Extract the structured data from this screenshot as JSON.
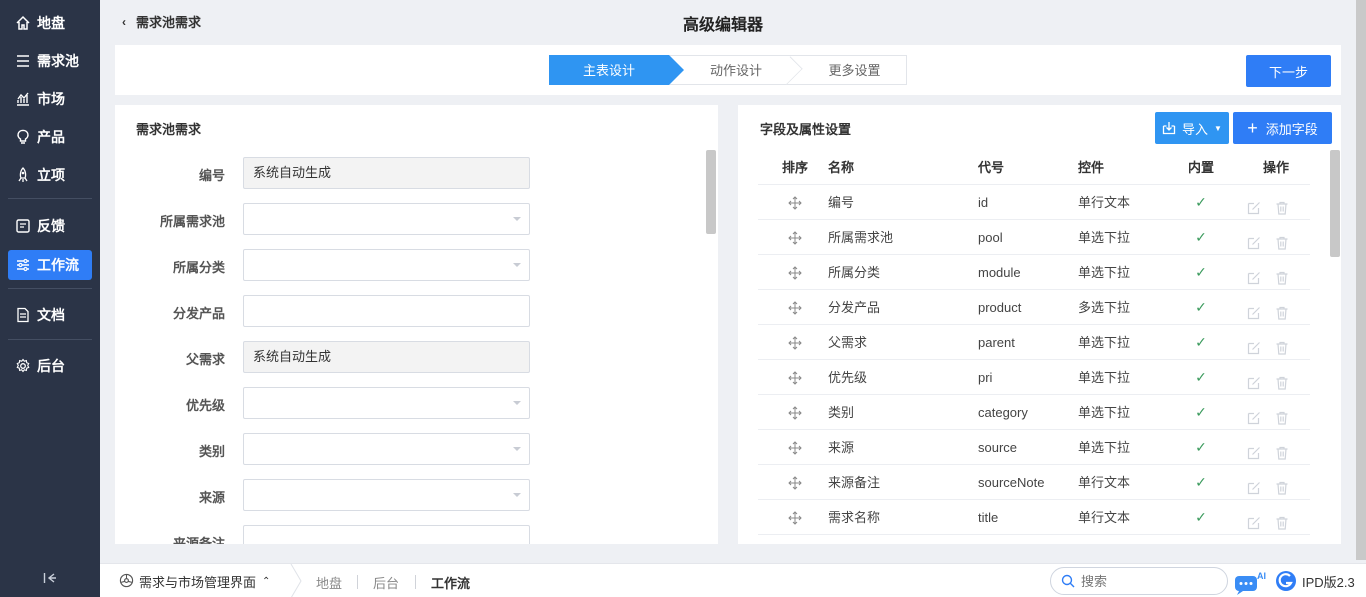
{
  "sidebar": {
    "items": [
      {
        "label": "地盘",
        "icon": "home-icon"
      },
      {
        "label": "需求池",
        "icon": "menu-lines-icon"
      },
      {
        "label": "市场",
        "icon": "chart-icon"
      },
      {
        "label": "产品",
        "icon": "lightbulb-icon"
      },
      {
        "label": "立项",
        "icon": "rocket-icon"
      },
      {
        "label": "反馈",
        "icon": "feedback-icon"
      },
      {
        "label": "工作流",
        "icon": "workflow-icon",
        "active": true
      },
      {
        "label": "文档",
        "icon": "document-icon"
      },
      {
        "label": "后台",
        "icon": "gear-icon"
      }
    ]
  },
  "header": {
    "back_label": "需求池需求",
    "title": "高级编辑器"
  },
  "steps": {
    "items": [
      "主表设计",
      "动作设计",
      "更多设置"
    ],
    "next_label": "下一步"
  },
  "form_panel": {
    "title": "需求池需求",
    "fields": [
      {
        "label": "编号",
        "value": "系统自动生成",
        "type": "readonly"
      },
      {
        "label": "所属需求池",
        "value": "",
        "type": "select"
      },
      {
        "label": "所属分类",
        "value": "",
        "type": "select"
      },
      {
        "label": "分发产品",
        "value": "",
        "type": "text"
      },
      {
        "label": "父需求",
        "value": "系统自动生成",
        "type": "readonly"
      },
      {
        "label": "优先级",
        "value": "",
        "type": "select"
      },
      {
        "label": "类别",
        "value": "",
        "type": "select"
      },
      {
        "label": "来源",
        "value": "",
        "type": "select"
      },
      {
        "label": "来源备注",
        "value": "",
        "type": "text"
      }
    ]
  },
  "field_panel": {
    "title": "字段及属性设置",
    "import_label": "导入",
    "add_label": "添加字段",
    "columns": [
      "排序",
      "名称",
      "代号",
      "控件",
      "内置",
      "操作"
    ],
    "rows": [
      {
        "name": "编号",
        "code": "id",
        "control": "单行文本",
        "builtin": "✓"
      },
      {
        "name": "所属需求池",
        "code": "pool",
        "control": "单选下拉",
        "builtin": "✓"
      },
      {
        "name": "所属分类",
        "code": "module",
        "control": "单选下拉",
        "builtin": "✓"
      },
      {
        "name": "分发产品",
        "code": "product",
        "control": "多选下拉",
        "builtin": "✓"
      },
      {
        "name": "父需求",
        "code": "parent",
        "control": "单选下拉",
        "builtin": "✓"
      },
      {
        "name": "优先级",
        "code": "pri",
        "control": "单选下拉",
        "builtin": "✓"
      },
      {
        "name": "类别",
        "code": "category",
        "control": "单选下拉",
        "builtin": "✓"
      },
      {
        "name": "来源",
        "code": "source",
        "control": "单选下拉",
        "builtin": "✓"
      },
      {
        "name": "来源备注",
        "code": "sourceNote",
        "control": "单行文本",
        "builtin": "✓"
      },
      {
        "name": "需求名称",
        "code": "title",
        "control": "单行文本",
        "builtin": "✓"
      }
    ]
  },
  "bottombar": {
    "app_label": "需求与市场管理界面",
    "links": [
      "地盘",
      "后台",
      "工作流"
    ],
    "search_placeholder": "搜索",
    "ai_badge": "AI",
    "version": "IPD版2.3"
  }
}
